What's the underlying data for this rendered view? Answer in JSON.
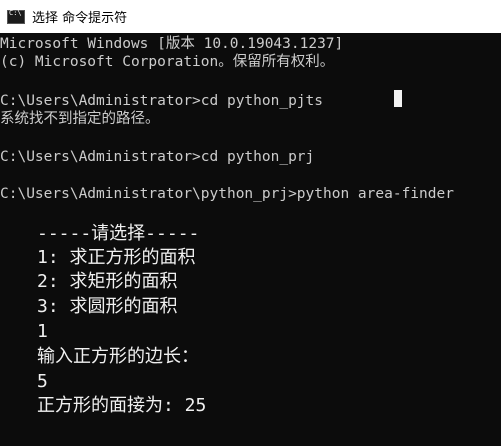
{
  "window": {
    "icon": "cmd-icon",
    "title": "选择 命令提示符"
  },
  "console": {
    "lines": [
      "Microsoft Windows [版本 10.0.19043.1237]",
      "(c) Microsoft Corporation。保留所有权利。",
      "",
      "C:\\Users\\Administrator>cd python_pjts",
      "系统找不到指定的路径。",
      "",
      "C:\\Users\\Administrator>cd python_prj",
      "",
      "C:\\Users\\Administrator\\python_prj>python area-finder"
    ],
    "output": [
      "-----请选择-----",
      "1: 求正方形的面积",
      "2: 求矩形的面积",
      "3: 求圆形的面积",
      "1",
      "输入正方形的边长：",
      "5",
      "正方形的面接为: 25"
    ]
  }
}
